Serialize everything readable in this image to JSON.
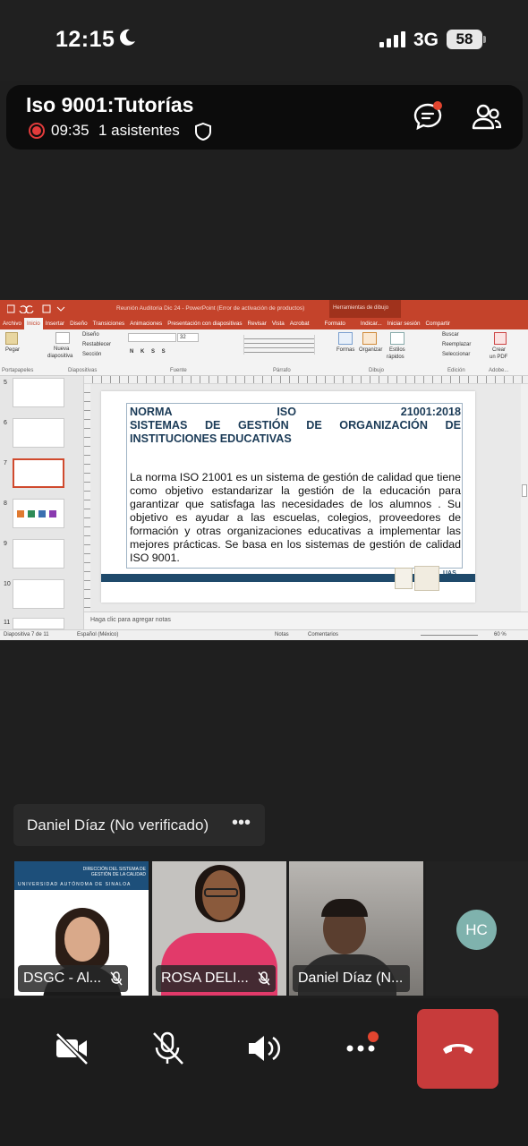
{
  "status_bar": {
    "time": "12:15",
    "network": "3G",
    "battery": "58"
  },
  "meeting": {
    "title": "Iso 9001:Tutorías",
    "elapsed": "09:35",
    "attendees": "1 asistentes"
  },
  "ppt": {
    "doc_title": "Reunión Auditoria Dic 24 - PowerPoint (Error de activación de productos)",
    "drawing_tools": "Herramientas de dibujo",
    "tabs": [
      "Archivo",
      "Inicio",
      "Insertar",
      "Diseño",
      "Transiciones",
      "Animaciones",
      "Presentación con diapositivas",
      "Revisar",
      "Vista",
      "Acrobat",
      "Formato",
      "Indicar...",
      "Iniciar sesión",
      "Compartir"
    ],
    "ribbon": {
      "pegar": "Pegar",
      "portapapeles": "Portapapeles",
      "nueva": "Nueva",
      "diapositiva": "diapositiva",
      "diseno": "Diseño",
      "restablecer": "Restablecer",
      "seccion": "Sección",
      "diapositivas": "Diapositivas",
      "font_size": "32",
      "fuente": "Fuente",
      "parrafo": "Párrafo",
      "formas": "Formas",
      "organizar": "Organizar",
      "estilos": "Estilos",
      "rapidos": "rápidos",
      "dibujo": "Dibujo",
      "buscar": "Buscar",
      "reemplazar": "Reemplazar",
      "seleccionar": "Seleccionar",
      "edicion": "Edición",
      "crear": "Crear",
      "en_pdf": "un PDF",
      "adobe": "Adobe..."
    },
    "thumb_numbers": [
      "5",
      "6",
      "7",
      "8",
      "9",
      "10",
      "11"
    ],
    "slide": {
      "title_row1_a": "NORMA",
      "title_row1_b": "ISO",
      "title_row1_c": "21001:2018",
      "title_row2": "SISTEMAS DE GESTIÓN DE ORGANIZACIÓN DE INSTITUCIONES EDUCATIVAS",
      "body": "La norma ISO 21001 es un sistema de gestión de calidad que tiene como objetivo estandarizar la gestión de la educación para garantizar que satisfaga las necesidades de los alumnos . Su objetivo es ayudar a las escuelas, colegios, proveedores de formación y otras organizaciones educativas a implementar las mejores prácticas. Se basa en los sistemas de gestión de calidad ISO 9001.",
      "logo_text": "UAS"
    },
    "notes_placeholder": "Haga clic para agregar notas",
    "status": {
      "slide": "Diapositiva 7 de 11",
      "language": "Español (México)",
      "notes": "Notas",
      "comments": "Comentarios",
      "zoom": "60 %"
    }
  },
  "active_speaker": {
    "name": "Daniel Díaz (No verificado)"
  },
  "participants": [
    {
      "label": "DSGC - Al...",
      "banner": "DIRECCIÓN DEL SISTEMA DE GESTIÓN DE LA CALIDAD",
      "banner2": "UNIVERSIDAD AUTÓNOMA DE SINALOA"
    },
    {
      "label": "ROSA DELI..."
    },
    {
      "label": "Daniel Díaz (N..."
    },
    {
      "initials": "HC"
    }
  ],
  "colors": {
    "ppt_red": "#c4432b",
    "hangup": "#c73b3b",
    "recording": "#e23b3b",
    "avatar": "#7fb2ad"
  }
}
